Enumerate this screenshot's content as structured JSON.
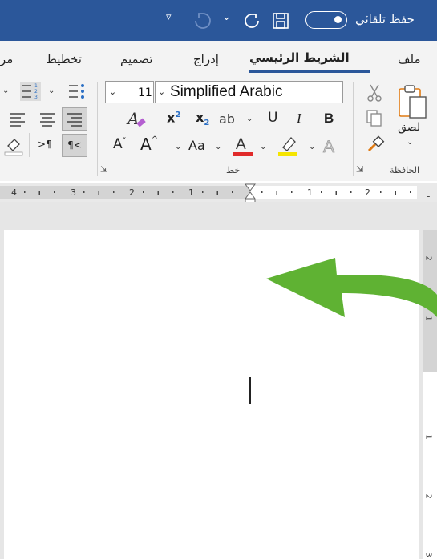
{
  "titlebar": {
    "autosave_label": "حفظ تلقائي",
    "quick_access_more": "▿",
    "redo_dropdown": "⌄"
  },
  "tabs": [
    {
      "label": "ملف"
    },
    {
      "label": "الشريط الرئيسي",
      "active": true
    },
    {
      "label": "إدراج"
    },
    {
      "label": "تصميم"
    },
    {
      "label": "تخطيط"
    },
    {
      "label": "مر"
    }
  ],
  "ribbon": {
    "clipboard": {
      "group_label": "الحافظة",
      "paste_label": "لصق",
      "paste_dropdown": "⌄"
    },
    "font": {
      "group_label": "خط",
      "font_name": "Simplified Arabic",
      "font_size": "11",
      "bold": "B",
      "italic": "I",
      "underline": "U",
      "strikethrough": "ab",
      "subscript_base": "x",
      "subscript": "2",
      "superscript_base": "x",
      "superscript": "2",
      "change_case": "Aa",
      "grow_font": "A",
      "shrink_font": "A",
      "font_color": "A",
      "clear_format": "A",
      "text_effects": "A",
      "font_color_value": "#e02a2a",
      "highlight_color_value": "#f5e500"
    },
    "paragraph": {
      "ltr": ">¶",
      "rtl": "¶<"
    }
  },
  "ruler": {
    "numbers_left": [
      "4",
      "3",
      "2",
      "1"
    ],
    "numbers_right": [
      "1",
      "2"
    ]
  },
  "vertical_ruler": {
    "numbers": [
      "2",
      "1",
      "1",
      "2",
      "3"
    ]
  },
  "annotation": {
    "arrow_color": "#5fb233"
  }
}
